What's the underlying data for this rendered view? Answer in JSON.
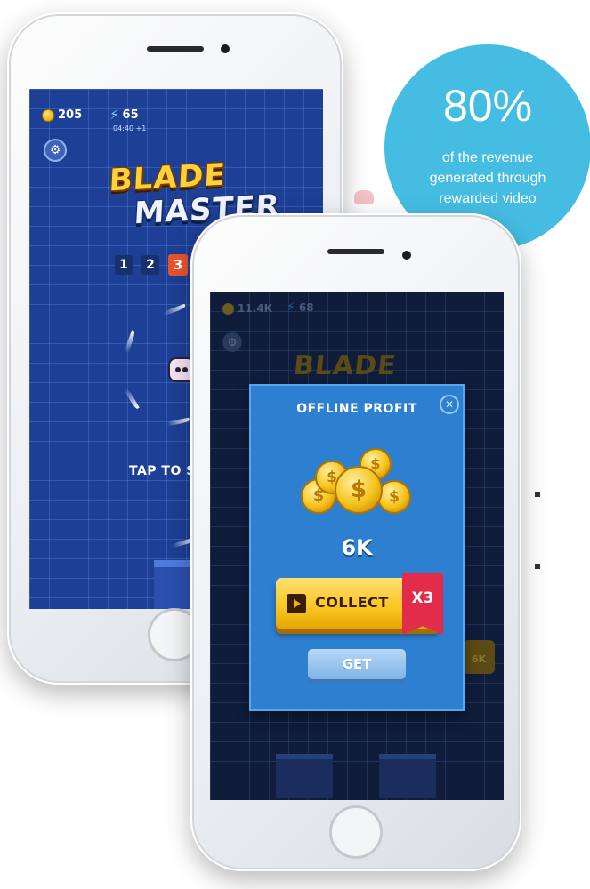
{
  "back_phone": {
    "coins": "205",
    "energy": "65",
    "timer": "04:40 +1",
    "logo_line1": "BLADE",
    "logo_line2": "MASTER",
    "levels": [
      "1",
      "2",
      "3"
    ],
    "active_level": "3",
    "tap_text": "TAP TO ST",
    "icons": {
      "coin": "coin-icon",
      "energy": "lightning-icon",
      "settings": "gear-icon"
    }
  },
  "front_phone": {
    "coins": "11.4K",
    "energy": "68",
    "background_logo": "BLADE",
    "badge_value": "6K",
    "dialog": {
      "title": "OFFLINE  PROFIT",
      "close_symbol": "✕",
      "amount": "6K",
      "collect_label": "COLLECT",
      "multiplier": "X3",
      "get_label": "GET",
      "coin_symbol": "$"
    },
    "icons": {
      "coin": "coin-icon",
      "energy": "lightning-icon",
      "settings": "gear-icon",
      "video": "play-icon",
      "close": "close-icon"
    }
  },
  "stat": {
    "value": "80%",
    "caption_line1": "of the revenue",
    "caption_line2": "generated through",
    "caption_line3": "rewarded video"
  },
  "colors": {
    "bubble": "#45bde3",
    "dialog": "#2d7fd0",
    "collect_button": "#f9c420",
    "multiplier_badge": "#e22c4a",
    "active_level": "#e9532f"
  }
}
